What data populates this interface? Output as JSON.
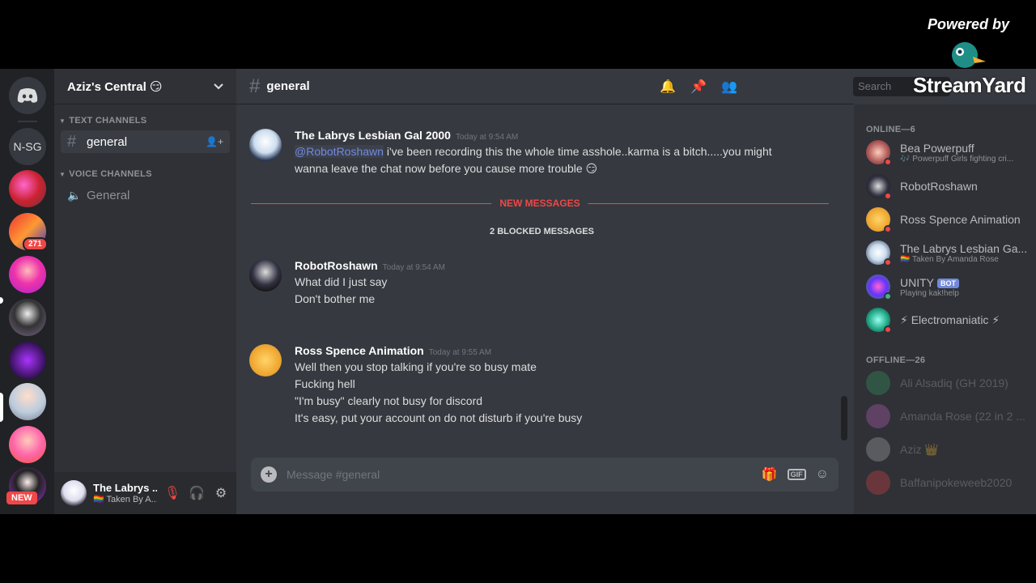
{
  "overlay": {
    "powered_by": "Powered by",
    "brand": "StreamYard"
  },
  "server": {
    "name": "Aziz's Central 😏",
    "nsg_label": "N-SG",
    "mentions_badge": "271",
    "new_badge": "NEW"
  },
  "sidebar": {
    "text_category": "TEXT CHANNELS",
    "voice_category": "VOICE CHANNELS",
    "text_channel": "general",
    "voice_channel": "General"
  },
  "user_panel": {
    "name": "The Labrys ...",
    "status": "🏳️‍🌈 Taken By A..."
  },
  "topbar": {
    "channel": "general",
    "search_placeholder": "Search"
  },
  "messages": [
    {
      "author": "The Labrys Lesbian Gal 2000",
      "time": "Today at 9:54 AM",
      "mention": "@RobotRoshawn",
      "line1": " i've been recording this the whole time asshole..karma is a bitch.....you might",
      "line2": "wanna leave the chat now before you cause more trouble 😏"
    },
    {
      "author": "RobotRoshawn",
      "time": "Today at 9:54 AM",
      "lines": [
        "What did I just say",
        "Don't bother me"
      ]
    },
    {
      "author": "Ross Spence Animation",
      "time": "Today at 9:55 AM",
      "lines": [
        "Well then you stop talking if you're so busy mate",
        "Fucking hell",
        "\"I'm busy\" clearly not busy for discord",
        "It's easy, put your account on do not disturb if you're busy"
      ]
    }
  ],
  "divider_label": "NEW MESSAGES",
  "blocked_label": "2 BLOCKED MESSAGES",
  "composer": {
    "placeholder": "Message #general",
    "gif_label": "GIF"
  },
  "members": {
    "online_header": "ONLINE—6",
    "offline_header": "OFFLINE—26",
    "online": [
      {
        "name": "Bea Powerpuff",
        "sub": "🎶 Powerpuff Girls fighting cri..."
      },
      {
        "name": "RobotRoshawn",
        "sub": ""
      },
      {
        "name": "Ross Spence Animation",
        "sub": ""
      },
      {
        "name": "The Labrys Lesbian Ga...",
        "sub": "🏳️‍🌈 Taken By Amanda Rose"
      },
      {
        "name": "UNITY",
        "badge": "BOT",
        "sub": "Playing kak!help"
      },
      {
        "name": "⚡ Electromaniatic ⚡",
        "sub": ""
      }
    ],
    "offline": [
      {
        "name": "Ali Alsadiq (GH 2019)"
      },
      {
        "name": "Amanda Rose (22 in 2 ..."
      },
      {
        "name": "Aziz 👑"
      },
      {
        "name": "Baffanipokeweeb2020"
      }
    ]
  },
  "colors": {
    "accent": "#7289da",
    "danger": "#f04747",
    "background": "#36393f"
  }
}
